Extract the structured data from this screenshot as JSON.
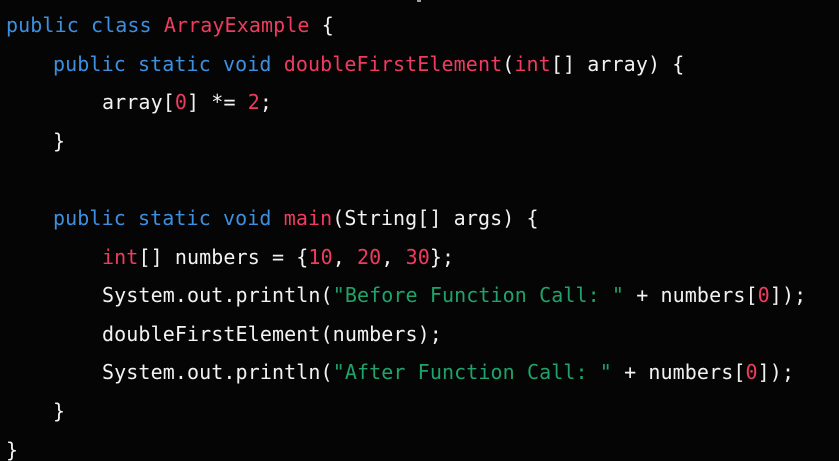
{
  "code_editor": {
    "colors": {
      "background": "#050505",
      "keyword": "#3d8fe0",
      "identifier_highlight": "#ef3b5f",
      "number": "#ef3b5f",
      "string": "#1fa36a",
      "plain": "#f2f2f2"
    },
    "lines": [
      {
        "indent": 0,
        "tokens": [
          {
            "type": "kw",
            "text": "public class "
          },
          {
            "type": "fn",
            "text": "ArrayExample"
          },
          {
            "type": "pl",
            "text": " {"
          }
        ]
      },
      {
        "indent": 1,
        "tokens": [
          {
            "type": "kw",
            "text": "public static void "
          },
          {
            "type": "fn",
            "text": "doubleFirstElement"
          },
          {
            "type": "pl",
            "text": "("
          },
          {
            "type": "fn",
            "text": "int"
          },
          {
            "type": "pl",
            "text": "[] array) {"
          }
        ]
      },
      {
        "indent": 2,
        "tokens": [
          {
            "type": "pl",
            "text": "array["
          },
          {
            "type": "num",
            "text": "0"
          },
          {
            "type": "pl",
            "text": "] *= "
          },
          {
            "type": "num",
            "text": "2"
          },
          {
            "type": "pl",
            "text": ";"
          }
        ]
      },
      {
        "indent": 1,
        "tokens": [
          {
            "type": "pl",
            "text": "}"
          }
        ]
      },
      {
        "indent": 0,
        "tokens": []
      },
      {
        "indent": 1,
        "tokens": [
          {
            "type": "kw",
            "text": "public static void "
          },
          {
            "type": "fn",
            "text": "main"
          },
          {
            "type": "pl",
            "text": "(String[] args) {"
          }
        ]
      },
      {
        "indent": 2,
        "tokens": [
          {
            "type": "fn",
            "text": "int"
          },
          {
            "type": "pl",
            "text": "[] numbers = {"
          },
          {
            "type": "num",
            "text": "10"
          },
          {
            "type": "pl",
            "text": ", "
          },
          {
            "type": "num",
            "text": "20"
          },
          {
            "type": "pl",
            "text": ", "
          },
          {
            "type": "num",
            "text": "30"
          },
          {
            "type": "pl",
            "text": "};"
          }
        ]
      },
      {
        "indent": 2,
        "tokens": [
          {
            "type": "pl",
            "text": "System.out.println("
          },
          {
            "type": "str",
            "text": "\"Before Function Call: \""
          },
          {
            "type": "pl",
            "text": " + numbers["
          },
          {
            "type": "num",
            "text": "0"
          },
          {
            "type": "pl",
            "text": "]);"
          }
        ]
      },
      {
        "indent": 2,
        "tokens": [
          {
            "type": "pl",
            "text": "doubleFirstElement(numbers);"
          }
        ]
      },
      {
        "indent": 2,
        "tokens": [
          {
            "type": "pl",
            "text": "System.out.println("
          },
          {
            "type": "str",
            "text": "\"After Function Call: \""
          },
          {
            "type": "pl",
            "text": " + numbers["
          },
          {
            "type": "num",
            "text": "0"
          },
          {
            "type": "pl",
            "text": "]);"
          }
        ]
      },
      {
        "indent": 1,
        "tokens": [
          {
            "type": "pl",
            "text": "}"
          }
        ]
      },
      {
        "indent": 0,
        "tokens": [
          {
            "type": "pl",
            "text": "}"
          }
        ]
      }
    ]
  }
}
